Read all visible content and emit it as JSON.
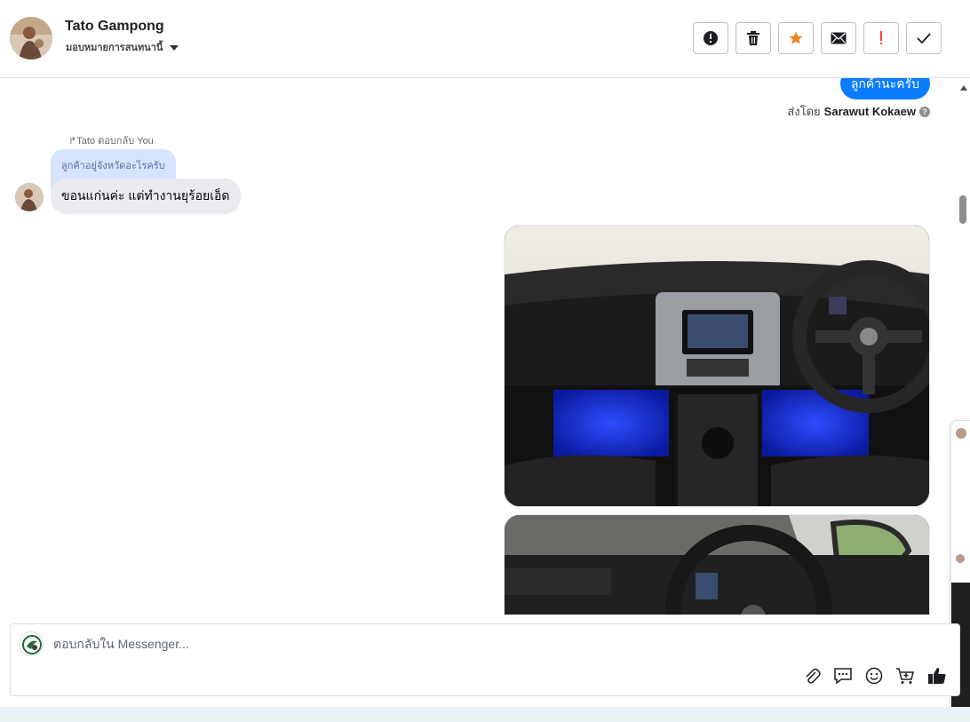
{
  "header": {
    "contact_name": "Tato Gampong",
    "assign_label": "มอบหมายการสนทนานี้"
  },
  "toolbar": {
    "buttons": [
      {
        "name": "spam",
        "icon": "alert-circle-icon"
      },
      {
        "name": "delete",
        "icon": "trash-icon"
      },
      {
        "name": "star",
        "icon": "star-icon",
        "color": "#f5821f"
      },
      {
        "name": "mark-unread",
        "icon": "envelope-icon"
      },
      {
        "name": "follow-up",
        "icon": "exclamation-icon",
        "color": "#fa3e3e"
      },
      {
        "name": "mark-done",
        "icon": "check-icon"
      }
    ]
  },
  "conversation": {
    "sent_top_text": "ลูกค้านะครับ",
    "sent_by_prefix": "ส่งโดย",
    "sent_by_name": "Sarawut Kokaew",
    "reply_meta": "Tato ตอบกลับ You",
    "quoted_text": "ลูกค้าอยู่จังหวัดอะไรครับ",
    "received_text": "ขอนแก่นค่ะ แต่ทำงานยุร้อยเอ็ด",
    "accent_color": "#0a7cff"
  },
  "composer": {
    "placeholder": "ตอบกลับใน Messenger...",
    "tools": [
      "attachment-icon",
      "saved-reply-icon",
      "emoji-icon",
      "cart-icon",
      "thumbs-up-icon"
    ]
  }
}
